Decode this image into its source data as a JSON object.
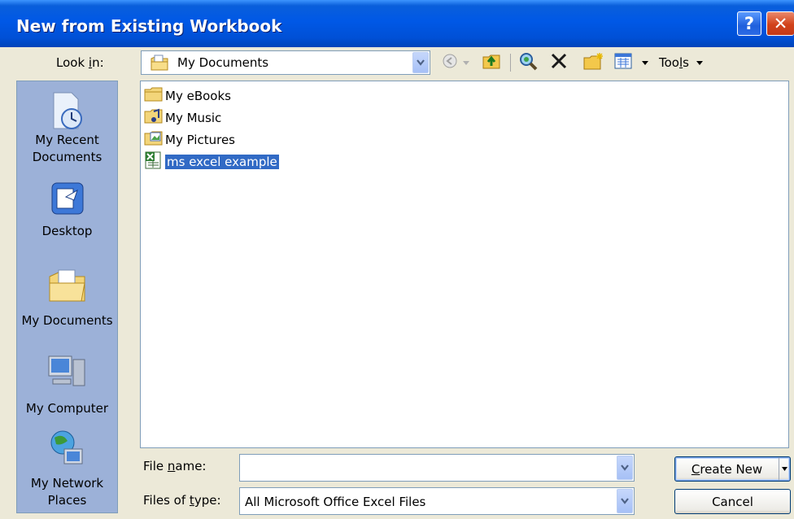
{
  "window": {
    "title": "New from Existing Workbook",
    "help_glyph": "?",
    "close_glyph": "✕"
  },
  "lookin": {
    "label_pre": "Look ",
    "label_accel": "i",
    "label_post": "n:",
    "value": "My Documents",
    "icon": "my-documents-icon"
  },
  "toolbar": {
    "items": [
      "back-icon",
      "up-one-level-icon",
      "search-web-icon",
      "delete-icon",
      "create-new-folder-icon",
      "views-icon"
    ],
    "tools_pre": "Too",
    "tools_accel": "l",
    "tools_post": "s"
  },
  "places": [
    {
      "line1": "My Recent",
      "line2": "Documents",
      "icon": "recent-documents-icon"
    },
    {
      "line1": "Desktop",
      "line2": "",
      "icon": "desktop-icon"
    },
    {
      "line1": "My Documents",
      "line2": "",
      "icon": "my-documents-icon"
    },
    {
      "line1": "My Computer",
      "line2": "",
      "icon": "my-computer-icon"
    },
    {
      "line1": "My Network",
      "line2": "Places",
      "icon": "network-places-icon"
    }
  ],
  "files": [
    {
      "name": "My eBooks",
      "icon": "folder-icon",
      "selected": false
    },
    {
      "name": "My Music",
      "icon": "music-folder-icon",
      "selected": false
    },
    {
      "name": "My Pictures",
      "icon": "pictures-folder-icon",
      "selected": false
    },
    {
      "name": "ms excel example",
      "icon": "excel-file-icon",
      "selected": true
    }
  ],
  "filename": {
    "label_pre": "File ",
    "label_accel": "n",
    "label_post": "ame:",
    "value": ""
  },
  "filetype": {
    "label_pre": "Files of ",
    "label_accel": "t",
    "label_post": "ype:",
    "value": "All Microsoft Office Excel Files"
  },
  "buttons": {
    "create_accel": "C",
    "create_rest": "reate New",
    "cancel": "Cancel"
  },
  "colors": {
    "titlebar": "#0058E6",
    "dialog_bg": "#ECE9D8",
    "places_bg": "#9CB1D8",
    "selection": "#316AC5"
  }
}
